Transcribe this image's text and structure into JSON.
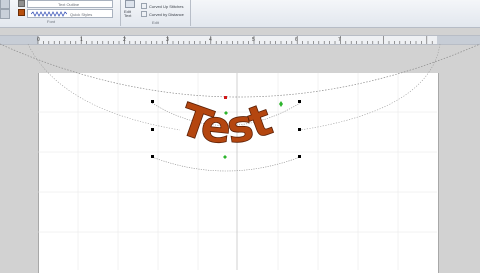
{
  "ribbon": {
    "shape_outline_label": "Text Outline",
    "shape_style_label": "Quick Styles",
    "group_font_label": "Font",
    "edit_text_label": "Edit Text",
    "curve_down_label": "Curved Up Stitches",
    "curve_up_label": "Curved by Distance",
    "group_edit_label": "Edit"
  },
  "ruler": {
    "numbers": [
      "0",
      "1",
      "2",
      "3",
      "4",
      "5",
      "6",
      "7"
    ]
  },
  "wordart": {
    "text": "Test",
    "fill_color": "#b4460f",
    "outline_color": "#5a1f05"
  },
  "colors": {
    "fill_swatch": "#b8500e",
    "handle_green": "#2db52d",
    "handle_red": "#d01818"
  }
}
